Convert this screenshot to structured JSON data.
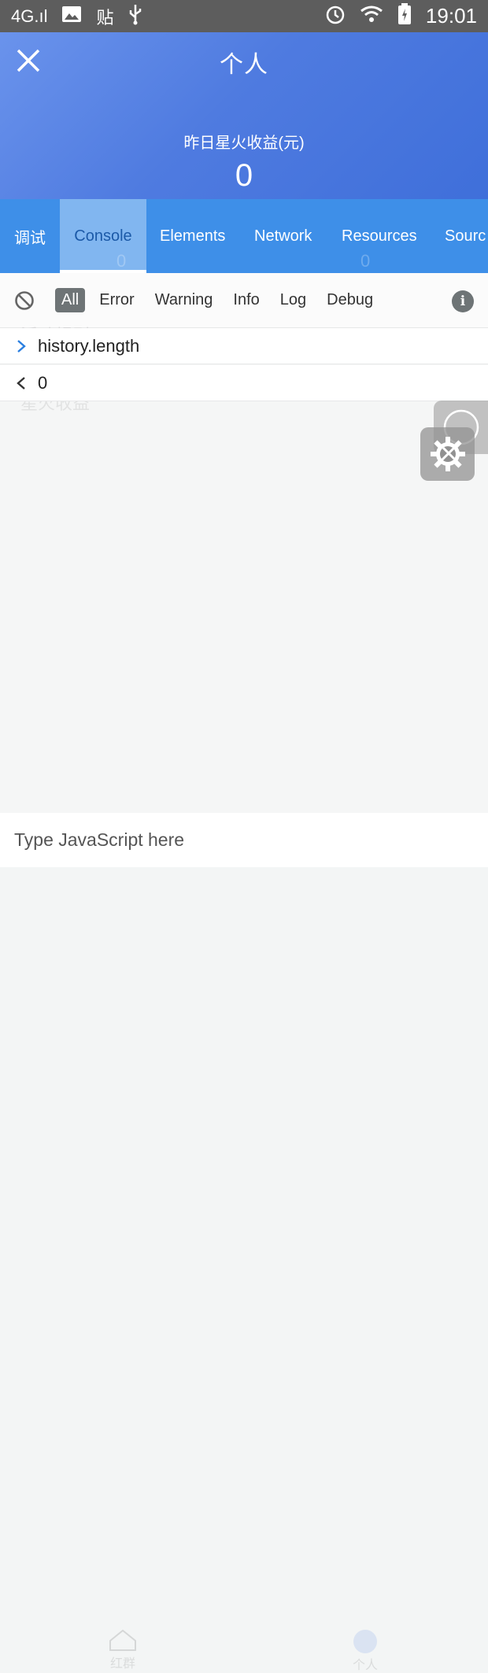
{
  "status_bar": {
    "network": "4G.ıl",
    "app_text": "贴",
    "time": "19:01"
  },
  "header": {
    "title": "个人",
    "earnings_label": "昨日星火收益(元)",
    "earnings_value": "0"
  },
  "tabs": [
    {
      "label": "调试",
      "active": false
    },
    {
      "label": "Console",
      "active": true
    },
    {
      "label": "Elements",
      "active": false
    },
    {
      "label": "Network",
      "active": false
    },
    {
      "label": "Resources",
      "active": false
    },
    {
      "label": "Sourc",
      "active": false
    }
  ],
  "tab_ghost_values": [
    "0",
    "0"
  ],
  "filters": [
    "All",
    "Error",
    "Warning",
    "Info",
    "Log",
    "Debug"
  ],
  "console_lines": [
    {
      "direction": "input",
      "text": "history.length"
    },
    {
      "direction": "output",
      "text": "0"
    }
  ],
  "ghost_text": {
    "rules": "活动规则",
    "earnings": "星火收益"
  },
  "bottom_nav_ghost": [
    "红群",
    "个人"
  ],
  "input": {
    "placeholder": "Type JavaScript here"
  },
  "colors": {
    "header_gradient_start": "#6a93ec",
    "header_gradient_end": "#3f6fda",
    "tab_bar": "#3e8fe8",
    "status_bar": "#5d5d5d"
  }
}
